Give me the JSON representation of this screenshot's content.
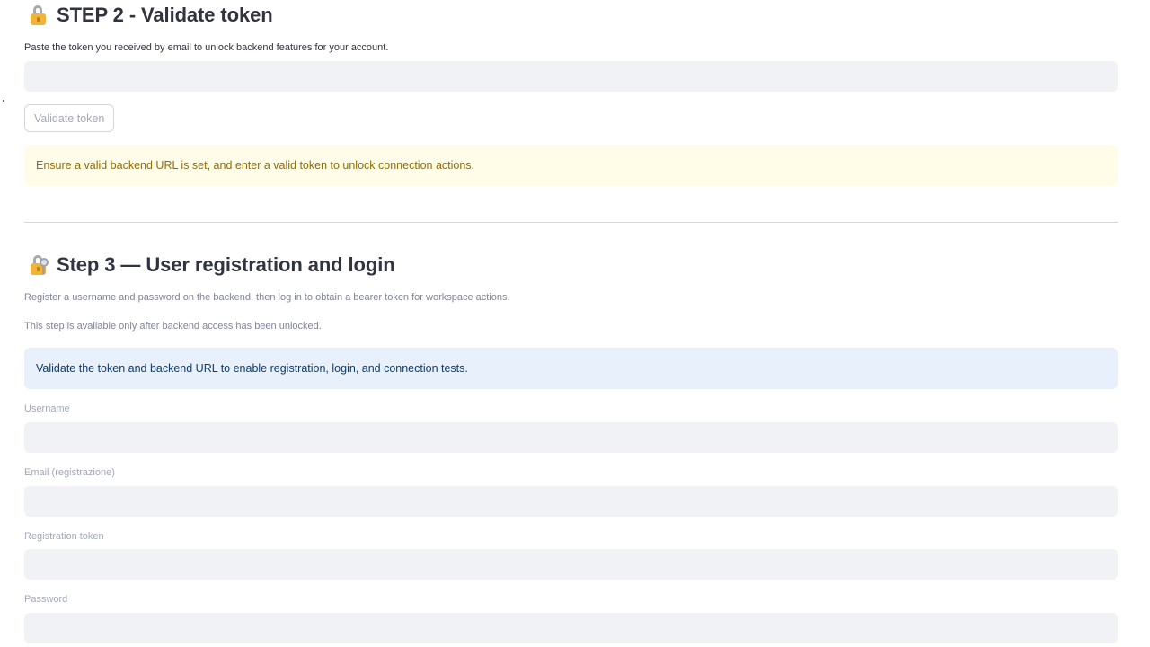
{
  "step2": {
    "title": "STEP 2 - Validate token",
    "icon": "lock-icon",
    "description": "Paste the token you received by email to unlock backend features for your account.",
    "token_input_value": "",
    "validate_button_label": "Validate token",
    "warning_text": "Ensure a valid backend URL is set, and enter a valid token to unlock connection actions."
  },
  "step3": {
    "title": "Step 3 — User registration and login",
    "icon": "lock-with-key-icon",
    "description": "Register a username and password on the backend, then log in to obtain a bearer token for workspace actions.",
    "availability_note": "This step is available only after backend access has been unlocked.",
    "info_text": "Validate the token and backend URL to enable registration, login, and connection tests.",
    "fields": {
      "username_label": "Username",
      "email_label": "Email (registrazione)",
      "registration_token_label": "Registration token",
      "password_label": "Password"
    }
  },
  "colors": {
    "warning_bg": "#fffce7",
    "warning_text": "#926c05",
    "info_bg": "#e8f1fb",
    "info_text": "#0e3c6e",
    "input_bg": "#f0f2f6"
  }
}
